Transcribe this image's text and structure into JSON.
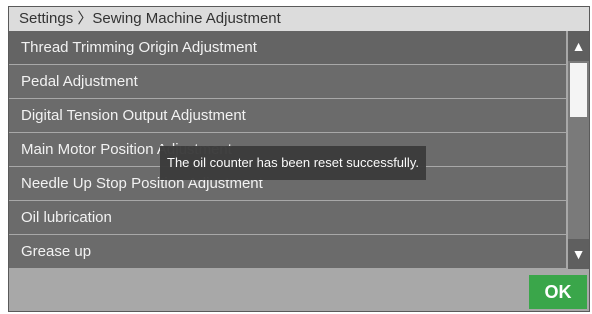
{
  "breadcrumb": "Settings 〉Sewing Machine Adjustment",
  "menu": {
    "items": [
      {
        "label": "Thread Trimming Origin Adjustment"
      },
      {
        "label": "Pedal Adjustment"
      },
      {
        "label": "Digital Tension Output Adjustment"
      },
      {
        "label": "Main Motor Position Adjustment"
      },
      {
        "label": "Needle Up Stop Position Adjustment"
      },
      {
        "label": "Oil lubrication"
      },
      {
        "label": "Grease up"
      }
    ]
  },
  "scrollbar": {
    "up_icon": "▲",
    "down_icon": "▼"
  },
  "toast": {
    "message": "The oil counter has been reset successfully."
  },
  "footer": {
    "ok_label": "OK"
  },
  "colors": {
    "row_bg": "#6b6b6b",
    "ok_green": "#3aa64a"
  }
}
